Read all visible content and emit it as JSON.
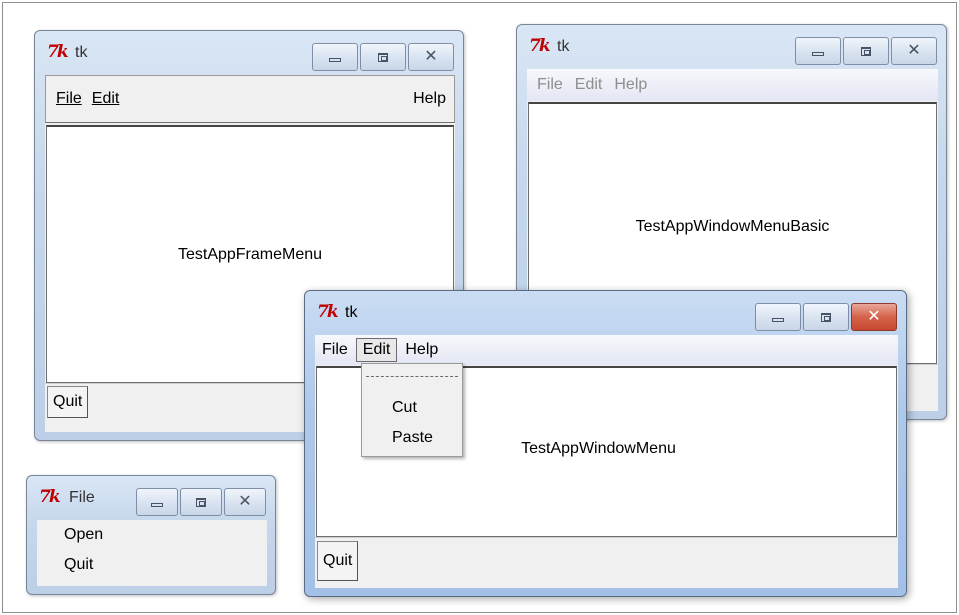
{
  "windows": {
    "frame_menu": {
      "title": "tk",
      "menu": {
        "file": "File",
        "edit": "Edit",
        "help": "Help"
      },
      "content_label": "TestAppFrameMenu",
      "quit_label": "Quit"
    },
    "window_menu_basic": {
      "title": "tk",
      "menu": {
        "file": "File",
        "edit": "Edit",
        "help": "Help"
      },
      "content_label": "TestAppWindowMenuBasic"
    },
    "window_menu": {
      "title": "tk",
      "menu": {
        "file": "File",
        "edit": "Edit",
        "help": "Help"
      },
      "content_label": "TestAppWindowMenu",
      "quit_label": "Quit",
      "dropdown": {
        "items": [
          "Cut",
          "Paste"
        ]
      }
    },
    "file_menu_window": {
      "title": "File",
      "items": [
        "Open",
        "Quit"
      ]
    }
  },
  "icons": {
    "app": "tk-feather-icon",
    "minimize": "minimize-icon",
    "maximize": "maximize-icon",
    "close": "close-icon"
  },
  "colors": {
    "close_active": "#c84830",
    "tk_logo": "#c00000",
    "titlebar": "#bccfe6"
  }
}
